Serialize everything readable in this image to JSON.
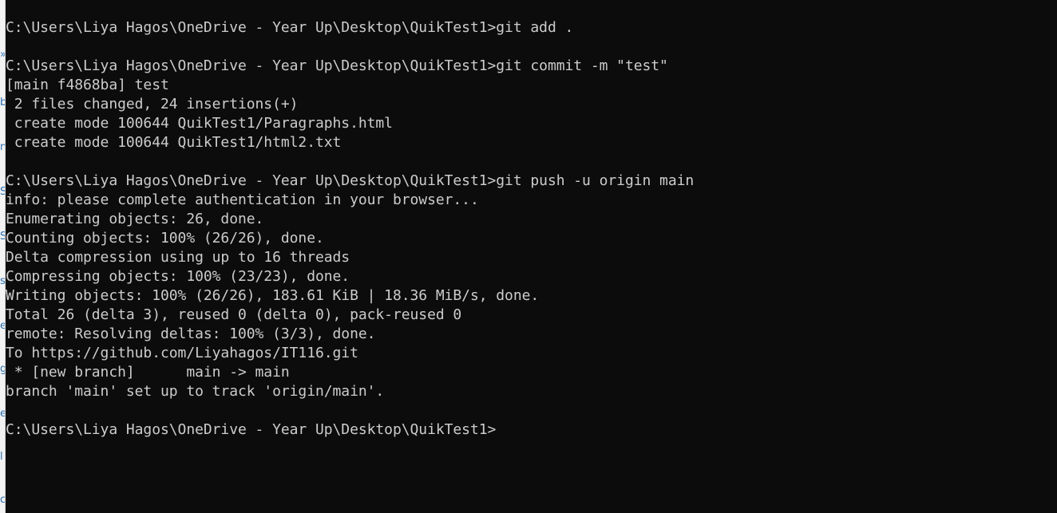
{
  "terminal": {
    "lines": [
      "C:\\Users\\Liya Hagos\\OneDrive - Year Up\\Desktop\\QuikTest1>git add .",
      "",
      "C:\\Users\\Liya Hagos\\OneDrive - Year Up\\Desktop\\QuikTest1>git commit -m \"test\"",
      "[main f4868ba] test",
      " 2 files changed, 24 insertions(+)",
      " create mode 100644 QuikTest1/Paragraphs.html",
      " create mode 100644 QuikTest1/html2.txt",
      "",
      "C:\\Users\\Liya Hagos\\OneDrive - Year Up\\Desktop\\QuikTest1>git push -u origin main",
      "info: please complete authentication in your browser...",
      "Enumerating objects: 26, done.",
      "Counting objects: 100% (26/26), done.",
      "Delta compression using up to 16 threads",
      "Compressing objects: 100% (23/23), done.",
      "Writing objects: 100% (26/26), 183.61 KiB | 18.36 MiB/s, done.",
      "Total 26 (delta 3), reused 0 (delta 0), pack-reused 0",
      "remote: Resolving deltas: 100% (3/3), done.",
      "To https://github.com/Liyahagos/IT116.git",
      " * [new branch]      main -> main",
      "branch 'main' set up to track 'origin/main'.",
      "",
      "C:\\Users\\Liya Hagos\\OneDrive - Year Up\\Desktop\\QuikTest1>"
    ]
  },
  "colors": {
    "background": "#0c0c0c",
    "text": "#cccccc"
  }
}
